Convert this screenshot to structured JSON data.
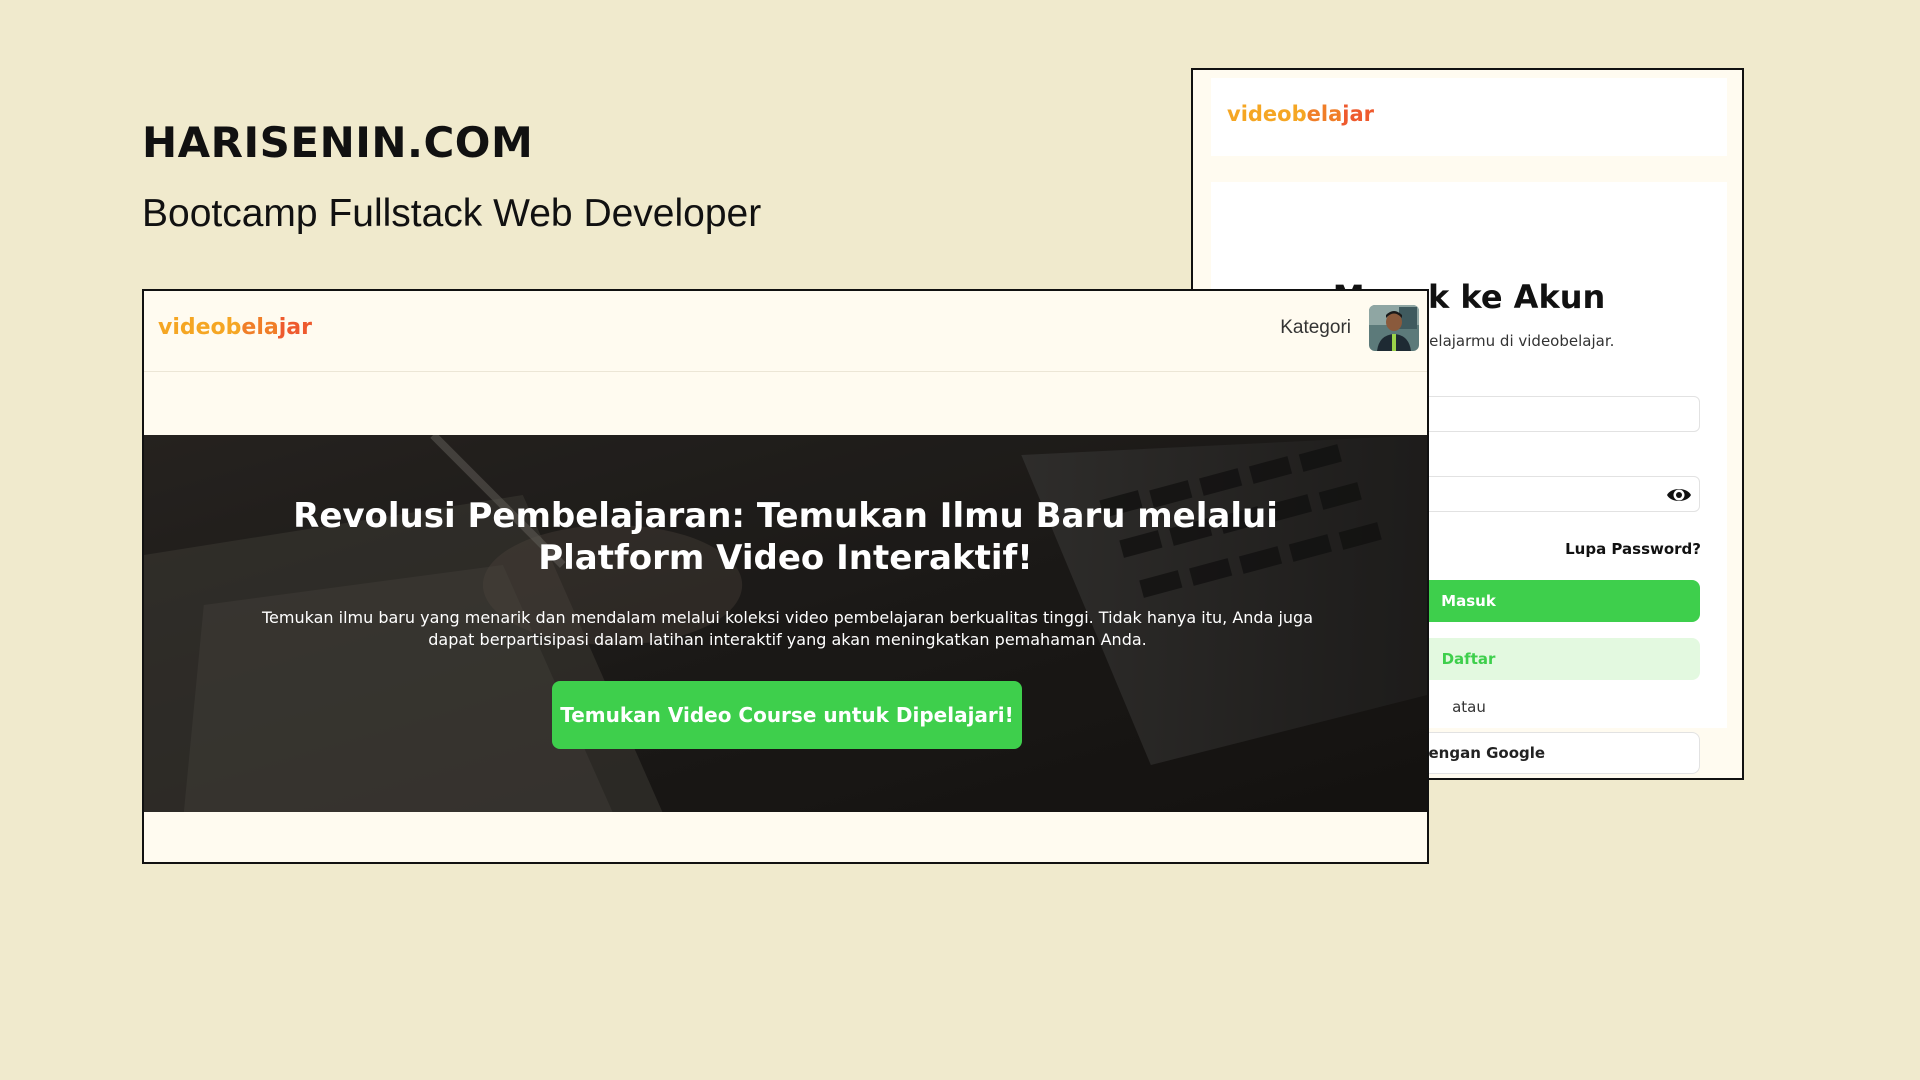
{
  "brand": {
    "title": "HARISENIN.COM",
    "subtitle": "Bootcamp Fullstack Web Developer"
  },
  "logo": {
    "part1": "videob",
    "part2": "ela",
    "part3": "jar"
  },
  "colors": {
    "background": "#F0EACD",
    "primary_green": "#3ECF4C",
    "light_green": "#E3F9E0",
    "logo_orange": "#F5A623",
    "logo_red": "#EE5A2E"
  },
  "login": {
    "title": "Masuk ke Akun",
    "subtitle": "Yuk, lanjutin belajarmu di videobelajar.",
    "forgot_password": "Lupa Password?",
    "masuk_label": "Masuk",
    "daftar_label": "Daftar",
    "separator": "atau",
    "google_label": "uk dengan Google",
    "password_toggle_icon": "eye-icon"
  },
  "landing": {
    "nav": {
      "kategori": "Kategori",
      "avatar_icon": "user-avatar"
    },
    "hero": {
      "title_line1": "Revolusi Pembelajaran: Temukan Ilmu Baru melalui",
      "title_line2": "Platform Video Interaktif!",
      "description": "Temukan ilmu baru yang menarik dan mendalam melalui koleksi video pembelajaran berkualitas tinggi. Tidak hanya itu, Anda juga dapat berpartisipasi dalam latihan interaktif yang akan meningkatkan pemahaman Anda.",
      "cta": "Temukan Video Course untuk Dipelajari!"
    }
  }
}
